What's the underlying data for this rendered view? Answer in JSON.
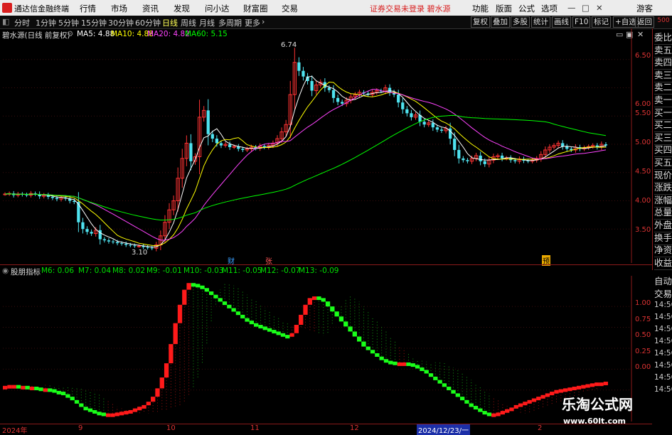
{
  "window": {
    "app_name": "通达信金融终端",
    "menus": [
      "行情",
      "市场",
      "资讯",
      "发现",
      "问小达",
      "财富圈",
      "交易"
    ],
    "notice": "证券交易未登录  碧水源",
    "right_tools": [
      "功能",
      "版面",
      "公式",
      "选项"
    ],
    "user": "游客"
  },
  "toolbar": {
    "timeframes": [
      "分时",
      "1分钟",
      "5分钟",
      "15分钟",
      "30分钟",
      "60分钟",
      "日线",
      "周线",
      "月线",
      "多周期",
      "更多"
    ],
    "active": "日线",
    "buttons": [
      "复权",
      "叠加",
      "多股",
      "统计",
      "画线",
      "F10",
      "标记",
      "+自选",
      "返回"
    ]
  },
  "main": {
    "title": "碧水源(日线 前复权)",
    "ma": [
      {
        "label": "MA5: 4.88",
        "color": "#ffffff"
      },
      {
        "label": "MA10: 4.88",
        "color": "#ffff00"
      },
      {
        "label": "MA20: 4.82",
        "color": "#ff44ff"
      },
      {
        "label": "MA60: 5.15",
        "color": "#00ff00"
      }
    ],
    "high_label": "6.74",
    "low_label": "3.10",
    "badges": {
      "cai": "财",
      "zhang": "张",
      "yu": "预"
    }
  },
  "sub": {
    "title": "股朋指标",
    "values": [
      {
        "label": "M6: 0.06"
      },
      {
        "label": "M7: 0.04"
      },
      {
        "label": "M8: 0.02"
      },
      {
        "label": "M9: -0.01"
      },
      {
        "label": "M10: -0.03"
      },
      {
        "label": "M11: -0.05"
      },
      {
        "label": "M12: -0.07"
      },
      {
        "label": "M13: -0.09"
      }
    ]
  },
  "right_panel": {
    "scale": "500",
    "items": [
      "委比",
      "卖五",
      "卖四",
      "卖三",
      "卖二",
      "卖一",
      "买一",
      "买二",
      "买三",
      "买四",
      "买五",
      "现价",
      "涨跌",
      "涨幅",
      "总量",
      "外盘",
      "换手",
      "净资",
      "收益"
    ],
    "auto": "自动",
    "trade": "交易",
    "times": [
      "14:56",
      "14:56",
      "14:56",
      "14:56",
      "14:56",
      "14:56",
      "14:56",
      "14:56"
    ]
  },
  "axes": {
    "main_y": [
      "6.50",
      "6.00",
      "5.50",
      "5.00",
      "4.50",
      "4.00",
      "3.50"
    ],
    "sub_y": [
      "1.00",
      "0.75",
      "0.50",
      "0.25",
      "0.00"
    ],
    "x_labels": [
      "2024年",
      "9",
      "10",
      "11",
      "12",
      "2024/12/23/一",
      "2"
    ]
  },
  "watermark": {
    "title": "乐淘公式网",
    "url": "www.60lt.com"
  },
  "chart_data": [
    {
      "type": "candlestick",
      "title": "碧水源(日线 前复权)",
      "ylim": [
        3.0,
        6.9
      ],
      "x_labels": [
        "2024年",
        "9",
        "10",
        "11",
        "12",
        "2024/12/23/一",
        "2"
      ],
      "annotations": [
        {
          "text": "6.74",
          "type": "high"
        },
        {
          "text": "3.10",
          "type": "low"
        }
      ],
      "close": [
        4.12,
        4.13,
        4.1,
        4.12,
        4.11,
        4.1,
        4.13,
        4.12,
        4.08,
        4.1,
        4.07,
        4.05,
        4.03,
        4.06,
        4.04,
        4.0,
        3.98,
        3.62,
        3.5,
        3.45,
        3.42,
        3.48,
        3.32,
        3.3,
        3.28,
        3.27,
        3.25,
        3.24,
        3.22,
        3.21,
        3.2,
        3.2,
        3.18,
        3.17,
        3.16,
        3.22,
        3.38,
        3.62,
        3.84,
        4.0,
        4.4,
        4.75,
        5.02,
        4.7,
        4.78,
        5.48,
        5.6,
        5.18,
        5.1,
        5.02,
        4.98,
        5.0,
        4.95,
        4.96,
        4.92,
        4.9,
        4.92,
        4.95,
        4.93,
        4.97,
        4.95,
        4.98,
        5.02,
        5.1,
        5.22,
        5.35,
        5.88,
        6.45,
        6.3,
        6.2,
        6.12,
        5.95,
        6.05,
        6.1,
        6.0,
        5.96,
        5.82,
        5.75,
        5.72,
        5.78,
        5.84,
        5.88,
        5.92,
        5.9,
        5.88,
        5.92,
        5.95,
        5.94,
        6.0,
        5.92,
        5.88,
        5.74,
        5.62,
        5.55,
        5.48,
        5.52,
        5.4,
        5.35,
        5.38,
        5.3,
        5.26,
        5.24,
        5.28,
        5.1,
        4.9,
        4.75,
        4.72,
        4.7,
        4.75,
        4.8,
        4.7,
        4.65,
        4.72,
        4.78,
        4.8,
        4.75,
        4.76,
        4.72,
        4.7,
        4.74,
        4.71,
        4.7,
        4.72,
        4.75,
        4.82,
        4.9,
        4.95,
        4.98,
        5.02,
        4.96,
        4.92,
        4.9,
        4.95,
        4.92,
        4.94,
        4.96,
        4.98,
        4.95,
        5.0,
        4.98
      ],
      "series": [
        {
          "name": "MA5",
          "color": "#ffffff"
        },
        {
          "name": "MA10",
          "color": "#ffff00"
        },
        {
          "name": "MA20",
          "color": "#ff44ff"
        },
        {
          "name": "MA60",
          "color": "#00ff00"
        }
      ]
    },
    {
      "type": "bar",
      "title": "股朋指标",
      "ylim": [
        -0.3,
        1.35
      ],
      "values": [
        0.05,
        0.06,
        0.06,
        0.05,
        0.05,
        0.04,
        0.04,
        0.03,
        0.02,
        0.02,
        0.01,
        -0.01,
        -0.02,
        -0.05,
        -0.08,
        -0.12,
        -0.16,
        -0.2,
        -0.22,
        -0.24,
        -0.26,
        -0.27,
        -0.28,
        -0.28,
        -0.28,
        -0.27,
        -0.26,
        -0.25,
        -0.24,
        -0.22,
        -0.2,
        -0.18,
        -0.14,
        -0.08,
        0.02,
        0.15,
        0.32,
        0.55,
        0.8,
        1.02,
        1.2,
        1.28,
        1.27,
        1.25,
        1.22,
        1.18,
        1.14,
        1.1,
        1.06,
        1.02,
        0.98,
        0.94,
        0.9,
        0.86,
        0.83,
        0.8,
        0.78,
        0.76,
        0.74,
        0.72,
        0.7,
        0.68,
        0.66,
        0.65,
        0.68,
        0.78,
        0.9,
        1.02,
        1.1,
        1.12,
        1.1,
        1.06,
        1.0,
        0.94,
        0.88,
        0.82,
        0.76,
        0.7,
        0.64,
        0.58,
        0.52,
        0.48,
        0.44,
        0.4,
        0.37,
        0.35,
        0.34,
        0.33,
        0.33,
        0.33,
        0.32,
        0.3,
        0.27,
        0.24,
        0.2,
        0.16,
        0.12,
        0.08,
        0.04,
        0.0,
        -0.04,
        -0.08,
        -0.12,
        -0.16,
        -0.19,
        -0.22,
        -0.25,
        -0.27,
        -0.28,
        -0.28,
        -0.27,
        -0.25,
        -0.23,
        -0.21,
        -0.18,
        -0.16,
        -0.14,
        -0.12,
        -0.1,
        -0.08,
        -0.06,
        -0.04,
        -0.02,
        0.0,
        0.01,
        0.02,
        0.03,
        0.04,
        0.05,
        0.06,
        0.07,
        0.08,
        0.09,
        0.09,
        0.1
      ]
    }
  ]
}
